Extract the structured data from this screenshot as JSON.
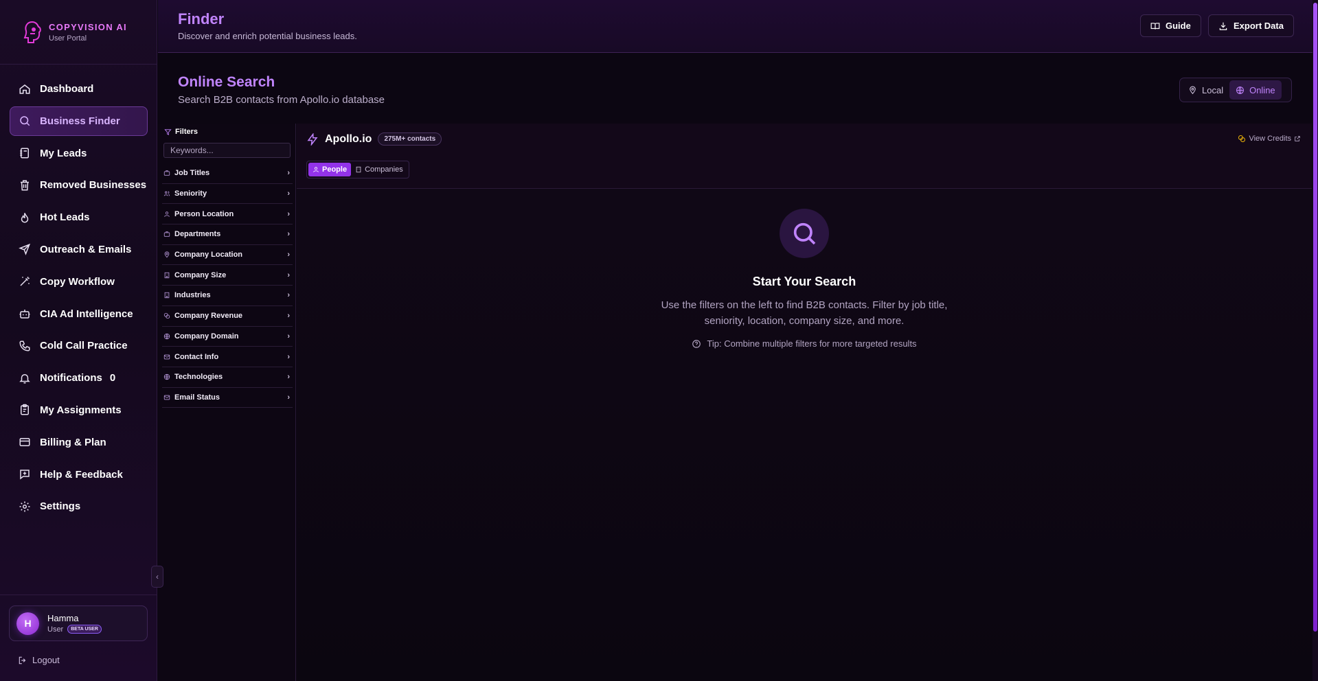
{
  "brand": {
    "name": "COPYVISION AI",
    "subtitle": "User Portal"
  },
  "nav": {
    "items": [
      {
        "label": "Dashboard",
        "icon": "home-icon"
      },
      {
        "label": "Business Finder",
        "icon": "search-icon",
        "active": true
      },
      {
        "label": "My Leads",
        "icon": "notebook-icon"
      },
      {
        "label": "Removed Businesses",
        "icon": "trash-icon"
      },
      {
        "label": "Hot Leads",
        "icon": "flame-icon"
      },
      {
        "label": "Outreach & Emails",
        "icon": "send-icon"
      },
      {
        "label": "Copy Workflow",
        "icon": "magic-wand-icon"
      },
      {
        "label": "CIA Ad Intelligence",
        "icon": "bot-icon"
      },
      {
        "label": "Cold Call Practice",
        "icon": "phone-icon"
      },
      {
        "label": "Notifications",
        "icon": "bell-icon",
        "badge": "0"
      },
      {
        "label": "My Assignments",
        "icon": "clipboard-icon"
      },
      {
        "label": "Billing & Plan",
        "icon": "credit-card-icon"
      },
      {
        "label": "Help & Feedback",
        "icon": "message-plus-icon"
      },
      {
        "label": "Settings",
        "icon": "gear-icon"
      }
    ]
  },
  "user": {
    "initial": "H",
    "name": "Hamma",
    "role": "User",
    "badge": "BETA USER"
  },
  "logout_label": "Logout",
  "header": {
    "title": "Finder",
    "subtitle": "Discover and enrich potential business leads.",
    "guide_label": "Guide",
    "export_label": "Export Data"
  },
  "search_section": {
    "title": "Online Search",
    "subtitle": "Search B2B contacts from Apollo.io database",
    "mode_local": "Local",
    "mode_online": "Online",
    "active_mode": "Online"
  },
  "filters": {
    "heading": "Filters",
    "keywords_placeholder": "Keywords...",
    "items": [
      {
        "label": "Job Titles",
        "icon": "briefcase-icon"
      },
      {
        "label": "Seniority",
        "icon": "users-icon"
      },
      {
        "label": "Person Location",
        "icon": "person-icon"
      },
      {
        "label": "Departments",
        "icon": "briefcase-icon"
      },
      {
        "label": "Company Location",
        "icon": "map-pin-icon"
      },
      {
        "label": "Company Size",
        "icon": "building-icon"
      },
      {
        "label": "Industries",
        "icon": "building-icon"
      },
      {
        "label": "Company Revenue",
        "icon": "coins-icon"
      },
      {
        "label": "Company Domain",
        "icon": "globe-icon"
      },
      {
        "label": "Contact Info",
        "icon": "mail-icon"
      },
      {
        "label": "Technologies",
        "icon": "globe-icon"
      },
      {
        "label": "Email Status",
        "icon": "mail-icon"
      }
    ]
  },
  "apollo": {
    "title": "Apollo.io",
    "contacts_badge": "275M+ contacts",
    "view_credits": "View Credits",
    "tab_people": "People",
    "tab_companies": "Companies",
    "active_tab": "People"
  },
  "empty_state": {
    "title": "Start Your Search",
    "description": "Use the filters on the left to find B2B contacts. Filter by job title, seniority, location, company size, and more.",
    "tip": "Tip: Combine multiple filters for more targeted results"
  },
  "colors": {
    "accent": "#c084fc",
    "accent_strong": "#9333ea",
    "brand_pink": "#e879f9",
    "background": "#0c0612",
    "credits_icon": "#eab308"
  }
}
